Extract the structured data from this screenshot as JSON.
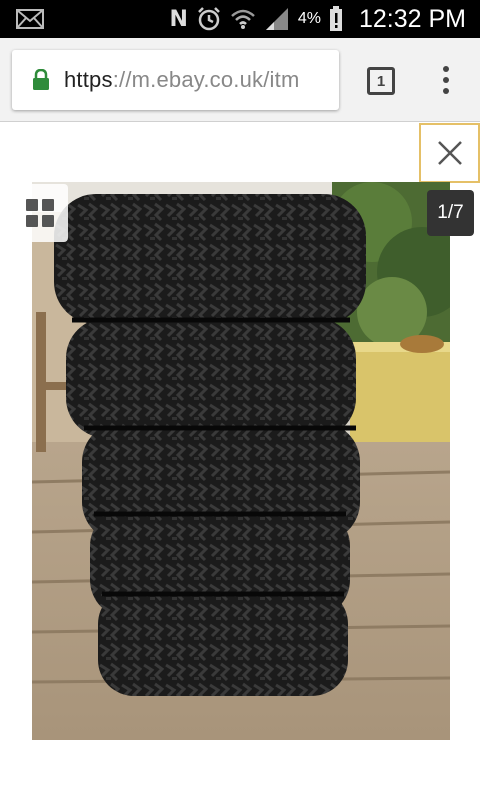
{
  "status_bar": {
    "battery_percent": "4%",
    "time": "12:32 PM",
    "icons": [
      "mail-icon",
      "nfc-icon",
      "alarm-icon",
      "wifi-icon",
      "signal-icon",
      "battery-alert-icon"
    ]
  },
  "browser": {
    "url_scheme": "https",
    "url_rest": "://m.ebay.co.uk/itm",
    "tab_count": "1",
    "secure_color": "#2e8b3a"
  },
  "gallery": {
    "counter": "1/7",
    "close_border_color": "#e5c067"
  }
}
